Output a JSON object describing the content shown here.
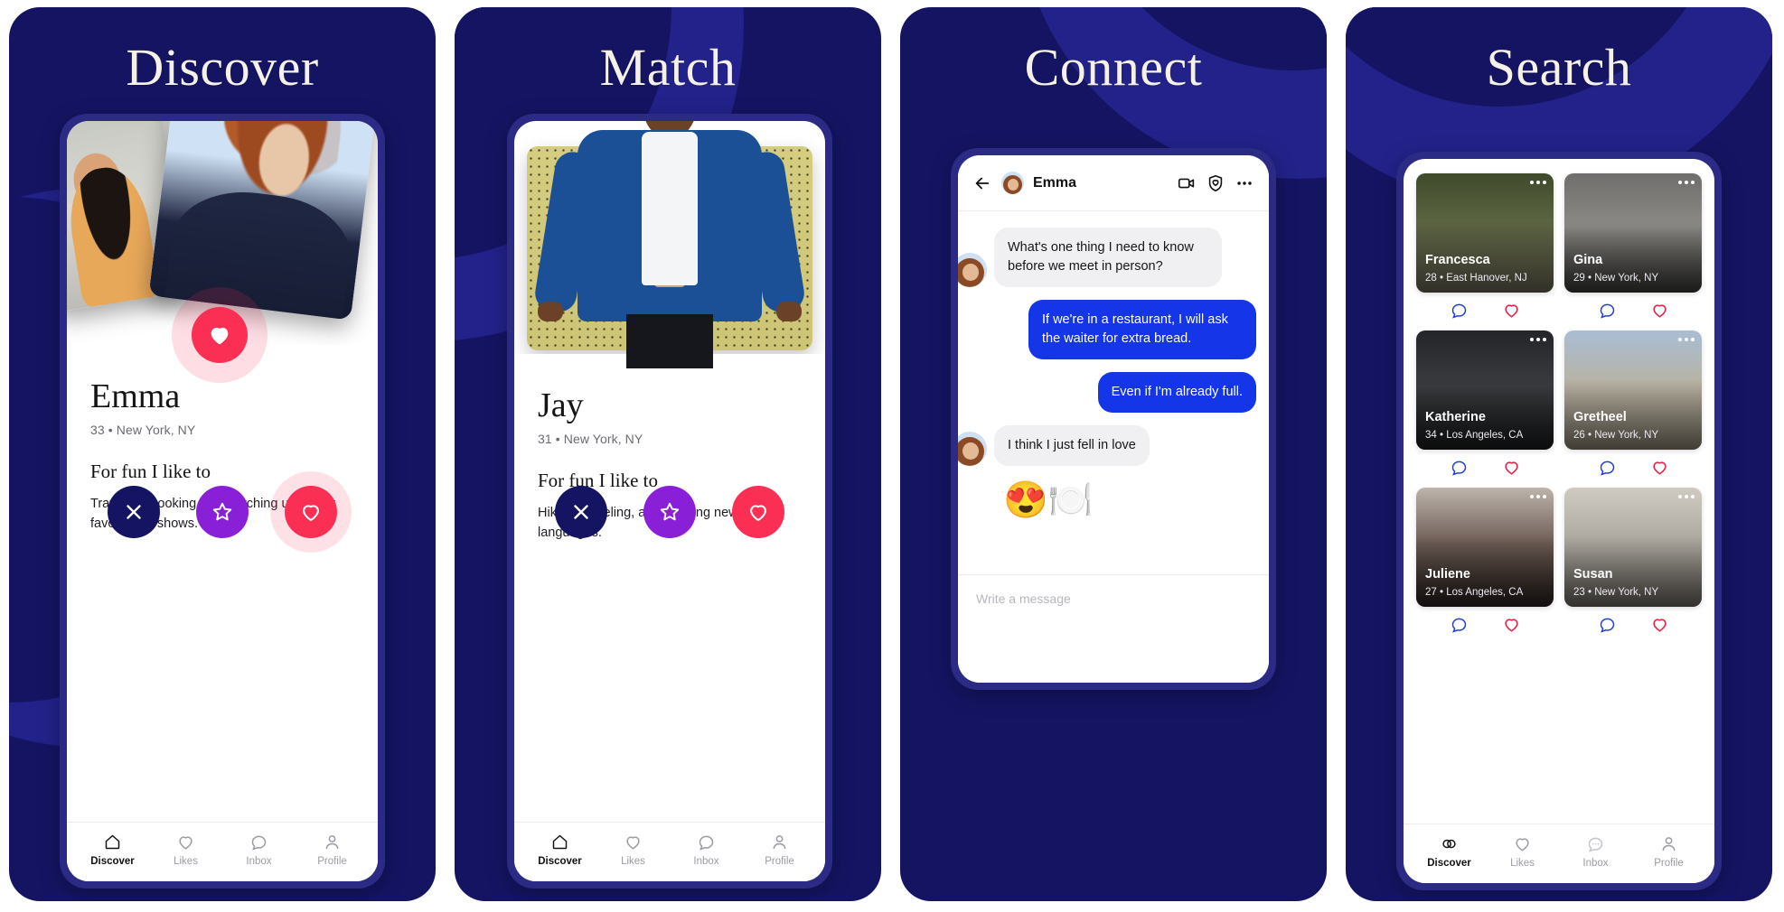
{
  "brand": {
    "bg_navy": "#141463",
    "accent_blue": "#1435e8",
    "accent_red": "#fb2e54",
    "accent_purple": "#8a1fd8"
  },
  "panels": [
    {
      "title": "Discover",
      "profile": {
        "name": "Emma",
        "meta": "33 • New York, NY",
        "prompt": "For fun I like to",
        "answer": "Traveling, cooking, and catching up on my favorite TV shows."
      },
      "actions": {
        "nope": "nope-button",
        "star": "super-like-button",
        "like": "like-button"
      },
      "tabs": [
        {
          "label": "Discover",
          "icon": "home-icon",
          "active": true
        },
        {
          "label": "Likes",
          "icon": "heart-icon",
          "active": false
        },
        {
          "label": "Inbox",
          "icon": "chat-bubble-icon",
          "active": false
        },
        {
          "label": "Profile",
          "icon": "person-icon",
          "active": false
        }
      ]
    },
    {
      "title": "Match",
      "profile": {
        "name": "Jay",
        "meta": "31 • New York, NY",
        "prompt": "For fun I like to",
        "answer": "Hiking, traveling, and learning new languages."
      },
      "tabs": [
        {
          "label": "Discover",
          "icon": "home-icon",
          "active": true
        },
        {
          "label": "Likes",
          "icon": "heart-icon",
          "active": false
        },
        {
          "label": "Inbox",
          "icon": "chat-bubble-icon",
          "active": false
        },
        {
          "label": "Profile",
          "icon": "person-icon",
          "active": false
        }
      ]
    },
    {
      "title": "Connect",
      "chat": {
        "contact_name": "Emma",
        "header_icons": [
          "back-arrow-icon",
          "video-call-icon",
          "shield-icon",
          "more-options-icon"
        ],
        "messages": [
          {
            "from": "in",
            "text": "What's one thing I need to know before we meet in person?"
          },
          {
            "from": "out",
            "text": "If we're in a restaurant, I will ask the waiter for extra bread."
          },
          {
            "from": "out",
            "text": "Even if I'm already full."
          },
          {
            "from": "in",
            "text": "I think I just fell in love"
          }
        ],
        "emoji_reply": "😍🍽️",
        "input_placeholder": "Write a message"
      }
    },
    {
      "title": "Search",
      "grid": [
        {
          "name": "Francesca",
          "meta": "28 • East Hanover, NJ",
          "photo": "p-francesca"
        },
        {
          "name": "Gina",
          "meta": "29 • New York, NY",
          "photo": "p-gina"
        },
        {
          "name": "Katherine",
          "meta": "34 • Los Angeles, CA",
          "photo": "p-katherine"
        },
        {
          "name": "Gretheel",
          "meta": "26 • New York, NY",
          "photo": "p-gretheel"
        },
        {
          "name": "Juliene",
          "meta": "27 • Los Angeles, CA",
          "photo": "p-juliene"
        },
        {
          "name": "Susan",
          "meta": "23 • New York, NY",
          "photo": "p-susan"
        }
      ],
      "card_actions": [
        "message-icon",
        "like-heart-icon"
      ],
      "tabs": [
        {
          "label": "Discover",
          "icon": "rings-icon",
          "active": true
        },
        {
          "label": "Likes",
          "icon": "heart-icon",
          "active": false
        },
        {
          "label": "Inbox",
          "icon": "chat-dots-icon",
          "active": false
        },
        {
          "label": "Profile",
          "icon": "person-icon",
          "active": false
        }
      ]
    }
  ]
}
